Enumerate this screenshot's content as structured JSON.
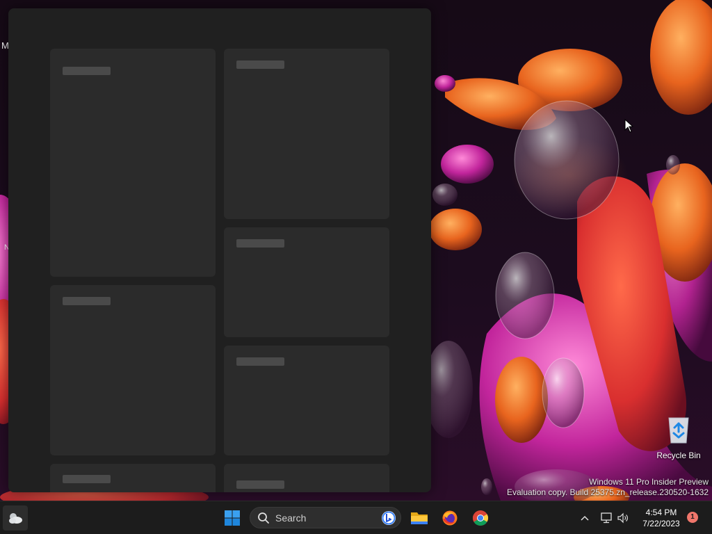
{
  "desktop": {
    "left_edge_text_1": "M",
    "left_edge_text_2": "N",
    "recycle_bin_label": "Recycle Bin",
    "watermark_line1": "Windows 11 Pro Insider Preview",
    "watermark_line2": "Evaluation copy. Build 25375.zn_release.230520-1632"
  },
  "widgets_panel": {
    "cards": [
      {
        "name": "widget-card-1"
      },
      {
        "name": "widget-card-2"
      },
      {
        "name": "widget-card-3"
      },
      {
        "name": "widget-card-4"
      },
      {
        "name": "widget-card-5"
      },
      {
        "name": "widget-card-6"
      },
      {
        "name": "widget-card-7"
      }
    ]
  },
  "taskbar": {
    "search_placeholder": "Search",
    "time": "4:54 PM",
    "date": "7/22/2023",
    "notification_count": "1",
    "icons": [
      "weather-icon",
      "windows-start-icon",
      "search-icon",
      "bing-icon",
      "file-explorer-icon",
      "firefox-icon",
      "chrome-icon",
      "chevron-up-icon",
      "network-icon",
      "volume-icon"
    ]
  }
}
